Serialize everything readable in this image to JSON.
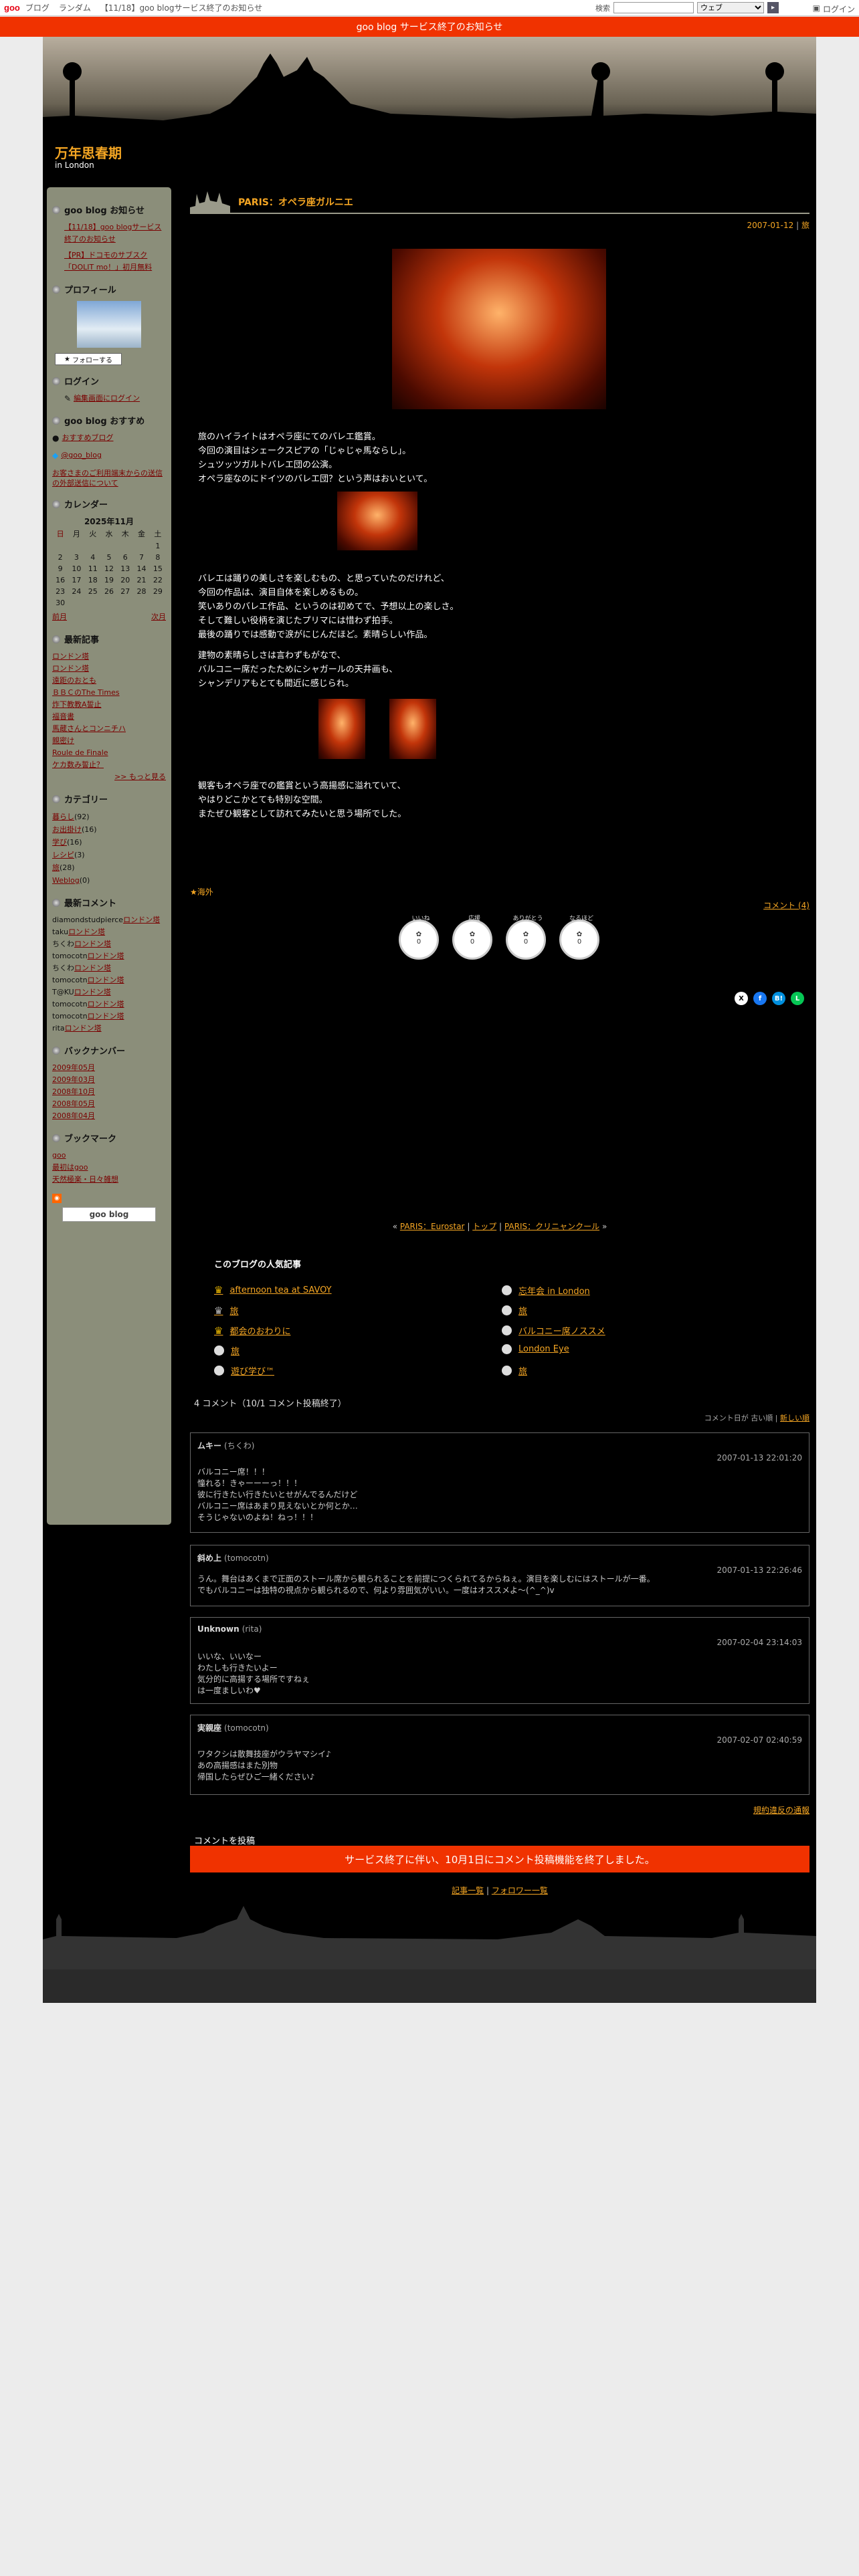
{
  "topbar": {
    "logo": "goo",
    "nav": [
      "ブログ",
      "ランダム",
      "【11/18】goo blogサービス終了のお知らせ"
    ],
    "search_label": "検索",
    "search_select": "ウェブ",
    "search_go": "▸",
    "login": "ログイン"
  },
  "notice": {
    "text": "goo blog サービス終了のお知らせ"
  },
  "blog": {
    "title": "万年思春期",
    "subtitle": "in London"
  },
  "side": {
    "info_title": "goo blog お知らせ",
    "info_items": [
      "【11/18】goo blogサービス終了のお知らせ",
      "【PR】ドコモのサブスク「DOLIT mo！」初月無料"
    ],
    "profile_title": "プロフィール",
    "follow": "フォローする",
    "login_title": "ログイン",
    "login_link": "編集画面にログイン",
    "recommend_title": "goo blog おすすめ",
    "recommend_link": "おすすめブログ",
    "twitter": "@goo_blog",
    "announce": "お客さまのご利用端末からの送信の外部送信について",
    "calendar_title": "カレンダー",
    "calendar_month": "2025年11月",
    "calendar_head": [
      "日",
      "月",
      "火",
      "水",
      "木",
      "金",
      "土"
    ],
    "calendar_rows": [
      [
        "",
        "",
        "",
        "",
        "",
        "",
        "1"
      ],
      [
        "2",
        "3",
        "4",
        "5",
        "6",
        "7",
        "8"
      ],
      [
        "9",
        "10",
        "11",
        "12",
        "13",
        "14",
        "15"
      ],
      [
        "16",
        "17",
        "18",
        "19",
        "20",
        "21",
        "22"
      ],
      [
        "23",
        "24",
        "25",
        "26",
        "27",
        "28",
        "29"
      ],
      [
        "30",
        "",
        "",
        "",
        "",
        "",
        ""
      ]
    ],
    "cal_prev": "前月",
    "cal_next": "次月",
    "recent_title": "最新記事",
    "recent": [
      "ロンドン塔",
      "ロンドン塔",
      "遠距のおとも",
      "ＢＢＣのThe Times",
      "炸下教教A誓止",
      "福音書",
      "馬蔵さんとコンニチハ",
      "親密け",
      "Roule de Finale",
      "ケカ数み誓止？"
    ],
    "more": ">> もっと見る",
    "cat_title": "カテゴリー",
    "cats": [
      {
        "n": "暮らし",
        "c": "(92)"
      },
      {
        "n": "お出掛け",
        "c": "(16)"
      },
      {
        "n": "学び",
        "c": "(16)"
      },
      {
        "n": "レシピ",
        "c": "(3)"
      },
      {
        "n": "旅",
        "c": "(28)"
      },
      {
        "n": "Weblog",
        "c": "(0)"
      }
    ],
    "cmt_title": "最新コメント",
    "cmts": [
      {
        "a": "diamondstudpierce",
        "l": "ロンドン塔"
      },
      {
        "a": "taku",
        "l": "ロンドン塔"
      },
      {
        "a": "ちくわ",
        "l": "ロンドン塔"
      },
      {
        "a": "tomocotn",
        "l": "ロンドン塔"
      },
      {
        "a": "ちくわ",
        "l": "ロンドン塔"
      },
      {
        "a": "tomocotn",
        "l": "ロンドン塔"
      },
      {
        "a": "T@KU",
        "l": "ロンドン塔"
      },
      {
        "a": "tomocotn",
        "l": "ロンドン塔"
      },
      {
        "a": "tomocotn",
        "l": "ロンドン塔"
      },
      {
        "a": "rita",
        "l": "ロンドン塔"
      }
    ],
    "back_title": "バックナンバー",
    "backs": [
      "2009年05月",
      "2009年03月",
      "2008年10月",
      "2008年05月",
      "2008年04月"
    ],
    "bm_title": "ブックマーク",
    "bms": [
      "goo",
      "最初はgoo",
      "天然極楽・日々雑想"
    ],
    "gooblog": "goo blog"
  },
  "post": {
    "title": "PARIS：オペラ座ガルニエ",
    "date": "2007-01-12",
    "sep": "|",
    "date_link": "旅",
    "p1": "旅のハイライトはオペラ座にてのバレエ鑑賞。\n今回の演目はシェークスピアの「じゃじゃ馬ならし」。\nシュツッツガルトバレエ団の公演。\nオペラ座なのにドイツのバレエ団？という声はおいといて。",
    "p2": "バレエは踊りの美しさを楽しむもの、と思っていたのだけれど、\n今回の作品は、演目自体を楽しめるもの。\n笑いありのバレエ作品、というのは初めてで、予想以上の楽しさ。\nそして難しい役柄を演じたプリマには惜わず拍手。\n最後の踊りでは感動で涙がにじんだほど。素晴らしい作品。",
    "p3": "建物の素晴らしさは言わずもがなで、\nバルコニー席だったためにシャガールの天井画も、\nシャンデリアもとても間近に感じられ。",
    "p4": "観客もオペラ座での鑑賞という高揚感に溢れていて、\nやはりどこかとても特別な空間。\nまたぜひ観客として訪れてみたいと思う場所でした。",
    "category": "★海外",
    "comment_link": "コメント (4)",
    "reactions": [
      {
        "l": "いいね",
        "v": "0"
      },
      {
        "l": "応援",
        "v": "0"
      },
      {
        "l": "ありがとう",
        "v": "0"
      },
      {
        "l": "なるほど",
        "v": "0"
      }
    ],
    "share": [
      "X",
      "f",
      "B!",
      "L"
    ]
  },
  "pager": {
    "prev": "PARIS：Eurostar",
    "top": "トップ",
    "next": "PARIS：クリニャンクール",
    "prev_arrow": "«",
    "next_arrow": "»",
    "sep": "|"
  },
  "popular": {
    "title": "このブログの人気記事",
    "left": [
      "afternoon tea at SAVOY",
      "旅",
      "都会のおわりに",
      "旅",
      "遊び学び™"
    ],
    "right": [
      "忘年会 in London",
      "旅",
      "バルコニー席ノススメ",
      "London Eye",
      "旅"
    ]
  },
  "comments": {
    "title": "4 コメント（10/1 コメント投稿終了）",
    "sort_label": "コメント日が",
    "sort_old": "古い順",
    "sort_new": "新しい順",
    "items": [
      {
        "name": "ムキー",
        "by": "(ちくわ)",
        "date": "2007-01-13 22:01:20",
        "body": "バルコニー席！！！\n憧れる！きゃーーーっ！！！\n彼に行きたい行きたいとせがんでるんだけど\nバルコニー席はあまり見えないとか何とか…\nそうじゃないのよね！ねっ！！！"
      },
      {
        "name": "斜め上",
        "by": "(tomocotn)",
        "date": "2007-01-13 22:26:46",
        "body": "うん。舞台はあくまで正面のストール席から観られることを前提につくられてるからねぇ。演目を楽しむにはストールが一番。\nでもバルコニーは独特の視点から観られるので、何より雰囲気がいい。一度はオススメよ〜(^_^)v"
      },
      {
        "name": "Unknown",
        "by": "(rita)",
        "date": "2007-02-04 23:14:03",
        "body": "いいな、いいなー\nわたしも行きたいよー\n気分的に高揚する場所ですねぇ\nは一度ましいわ♥"
      },
      {
        "name": "実親座",
        "by": "(tomocotn)",
        "date": "2007-02-07 02:40:59",
        "body": "ワタクシは散舞技座がウラヤマシイ♪\nあの高揚感はまた別物\n帰国したらぜひご一緒ください♪"
      }
    ],
    "rules": "規約違反の通報",
    "post_title": "コメントを投稿",
    "closed": "サービス終了に伴い、10月1日にコメント投稿機能を終了しました。",
    "list": "記事一覧",
    "followers": "フォロワー一覧",
    "list_sep": "|"
  },
  "colors": {
    "accent": "#f5a623",
    "notice": "#f03200",
    "sidebar": "#8b8e7a"
  }
}
